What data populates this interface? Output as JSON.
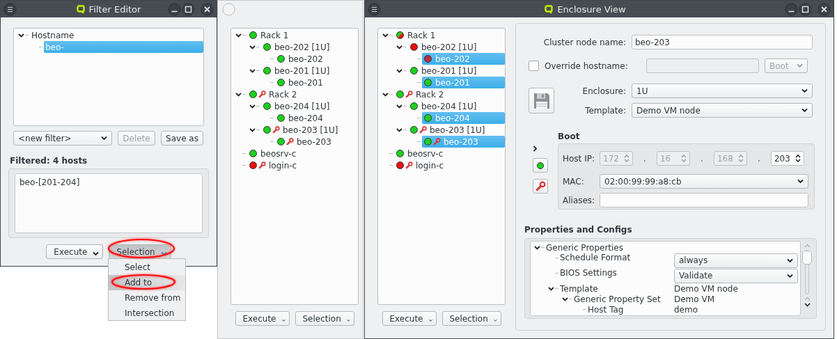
{
  "filter_editor": {
    "title": "Filter Editor",
    "tree": [
      {
        "label": "Hostname",
        "expanded": true,
        "selected": false,
        "children": [
          {
            "label": "beo-",
            "selected": true
          }
        ]
      }
    ],
    "filter_combo": "<new filter>",
    "buttons": [
      {
        "label": "Delete",
        "disabled": true
      },
      {
        "label": "Save as",
        "disabled": false
      }
    ],
    "filtered_label": "Filtered: 4 hosts",
    "filter_result": "beo-[201-204]",
    "execute_button": "Execute",
    "selection_button": {
      "label": "Selection",
      "pressed": true,
      "circled": true
    },
    "selection_menu": [
      {
        "label": "Select",
        "selected": false,
        "circled": false
      },
      {
        "label": "Add to",
        "selected": true,
        "circled": true
      },
      {
        "label": "Remove from",
        "selected": false,
        "circled": false
      },
      {
        "label": "Intersection",
        "selected": false,
        "circled": false
      }
    ]
  },
  "cluster_view": {
    "tree": [
      {
        "label": "Rack 1",
        "color": "#1ed01e",
        "maintenance": false,
        "selected": false,
        "expanded": true,
        "children": [
          {
            "label": "beo-202 [1U]",
            "color": "#1ed01e",
            "maintenance": false,
            "selected": false,
            "expanded": true,
            "children": [
              {
                "label": "beo-202",
                "color": "#1ed01e",
                "maintenance": false,
                "selected": false
              }
            ]
          },
          {
            "label": "beo-201 [1U]",
            "color": "#1ed01e",
            "maintenance": false,
            "selected": false,
            "expanded": true,
            "children": [
              {
                "label": "beo-201",
                "color": "#1ed01e",
                "maintenance": false,
                "selected": false
              }
            ]
          }
        ]
      },
      {
        "label": "Rack 2",
        "color": "#1ed01e",
        "maintenance": true,
        "selected": false,
        "expanded": true,
        "children": [
          {
            "label": "beo-204 [1U]",
            "color": "#1ed01e",
            "maintenance": false,
            "selected": false,
            "expanded": true,
            "children": [
              {
                "label": "beo-204",
                "color": "#1ed01e",
                "maintenance": false,
                "selected": false
              }
            ]
          },
          {
            "label": "beo-203 [1U]",
            "color": "#1ed01e",
            "maintenance": true,
            "selected": false,
            "expanded": true,
            "children": [
              {
                "label": "beo-203",
                "color": "#1ed01e",
                "maintenance": true,
                "selected": false
              }
            ]
          }
        ]
      },
      {
        "label": "beosrv-c",
        "color": "#1ed01e",
        "maintenance": false,
        "selected": false
      },
      {
        "label": "login-c",
        "color": "#e81010",
        "maintenance": true,
        "selected": false
      }
    ],
    "execute_button": "Execute",
    "selection_button": "Selection"
  },
  "enclosure_view": {
    "title": "Enclosure View",
    "tree": [
      {
        "label": "Rack 1",
        "dot_parts": [
          {
            "color": "#1ed01e"
          },
          {
            "color": "#e81010"
          }
        ],
        "maintenance": false,
        "selected": false,
        "expanded": true,
        "children": [
          {
            "label": "beo-202 [1U]",
            "color": "#e81010",
            "maintenance": false,
            "selected": false,
            "expanded": true,
            "children": [
              {
                "label": "beo-202",
                "color": "#b83040",
                "maintenance": false,
                "selected": true
              }
            ]
          },
          {
            "label": "beo-201 [1U]",
            "color": "#1ed01e",
            "maintenance": false,
            "selected": false,
            "expanded": true,
            "children": [
              {
                "label": "beo-201",
                "color": "#1ed01e",
                "maintenance": false,
                "selected": true
              }
            ]
          }
        ]
      },
      {
        "label": "Rack 2",
        "color": "#1ed01e",
        "maintenance": true,
        "selected": false,
        "expanded": true,
        "children": [
          {
            "label": "beo-204 [1U]",
            "color": "#1ed01e",
            "maintenance": false,
            "selected": false,
            "expanded": true,
            "children": [
              {
                "label": "beo-204",
                "color": "#1ed01e",
                "maintenance": false,
                "selected": true
              }
            ]
          },
          {
            "label": "beo-203 [1U]",
            "color": "#1ed01e",
            "maintenance": true,
            "selected": false,
            "expanded": true,
            "children": [
              {
                "label": "beo-203",
                "color": "#1ed01e",
                "maintenance": true,
                "selected": true
              }
            ]
          }
        ]
      },
      {
        "label": "beosrv-c",
        "color": "#1ed01e",
        "maintenance": false,
        "selected": false
      },
      {
        "label": "login-c",
        "color": "#e81010",
        "maintenance": true,
        "selected": false
      }
    ],
    "execute_button": "Execute",
    "selection_button": "Selection",
    "form": {
      "cluster_node_name_label": "Cluster node name:",
      "cluster_node_name": "beo-203",
      "override_label": "Override hostname:",
      "override_checked": false,
      "override_field_disabled": true,
      "boot_combo": {
        "value": "Boot",
        "disabled": true
      },
      "enclosure_label": "Enclosure:",
      "enclosure": "1U",
      "template_label": "Template:",
      "template": "Demo VM node"
    },
    "boot": {
      "title": "Boot",
      "host_ip_label": "Host IP:",
      "host_ip": [
        {
          "value": "172",
          "disabled": true,
          "separator": "."
        },
        {
          "value": "16",
          "disabled": true,
          "separator": "."
        },
        {
          "value": "168",
          "disabled": true,
          "separator": "."
        },
        {
          "value": "203",
          "disabled": false
        }
      ],
      "mac_label": "MAC:",
      "mac": "02:00:99:99:a8:cb",
      "aliases_label": "Aliases:"
    },
    "properties": {
      "title": "Properties and Configs",
      "tree": [
        {
          "label": "Generic Properties",
          "expanded": true,
          "children": [
            {
              "label": "Schedule Format",
              "kind": "combo",
              "value": "always"
            },
            {
              "label": "BIOS Settings",
              "kind": "combo",
              "value": "Validate"
            },
            {
              "label": "Template",
              "kind": "text",
              "value": "Demo VM node",
              "expanded": true,
              "children": [
                {
                  "label": "Generic Property Set",
                  "kind": "text",
                  "value": "Demo VM",
                  "expanded": true,
                  "children": [
                    {
                      "label": "Host Tag",
                      "kind": "text",
                      "value": "demo"
                    }
                  ]
                }
              ]
            }
          ]
        }
      ]
    }
  }
}
